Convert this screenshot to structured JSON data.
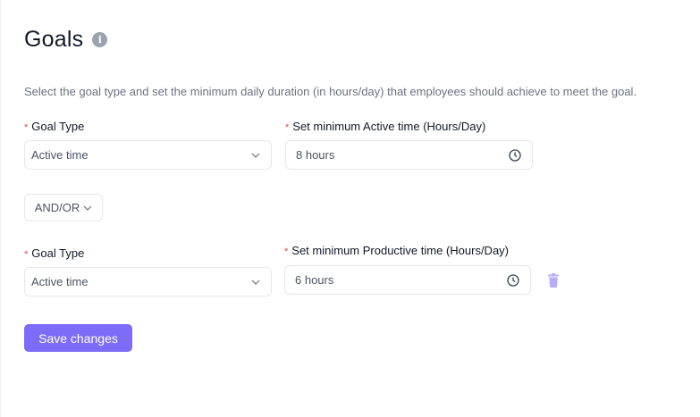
{
  "header": {
    "title": "Goals",
    "info_icon": "info-icon"
  },
  "description": "Select the goal type and set the minimum daily duration (in hours/day) that employees should achieve to meet the goal.",
  "goals": [
    {
      "type_label": "Goal Type",
      "type_value": "Active time",
      "time_label": "Set minimum Active time (Hours/Day)",
      "time_value": "8 hours"
    },
    {
      "type_label": "Goal Type",
      "type_value": "Active time",
      "time_label": "Set minimum Productive time (Hours/Day)",
      "time_value": "6 hours"
    }
  ],
  "operator": {
    "label": "AND/OR"
  },
  "required_mark": "*",
  "actions": {
    "save_label": "Save changes"
  },
  "colors": {
    "accent": "#7c6cf7",
    "required": "#ef4444",
    "trash_icon": "#b9adf8"
  }
}
